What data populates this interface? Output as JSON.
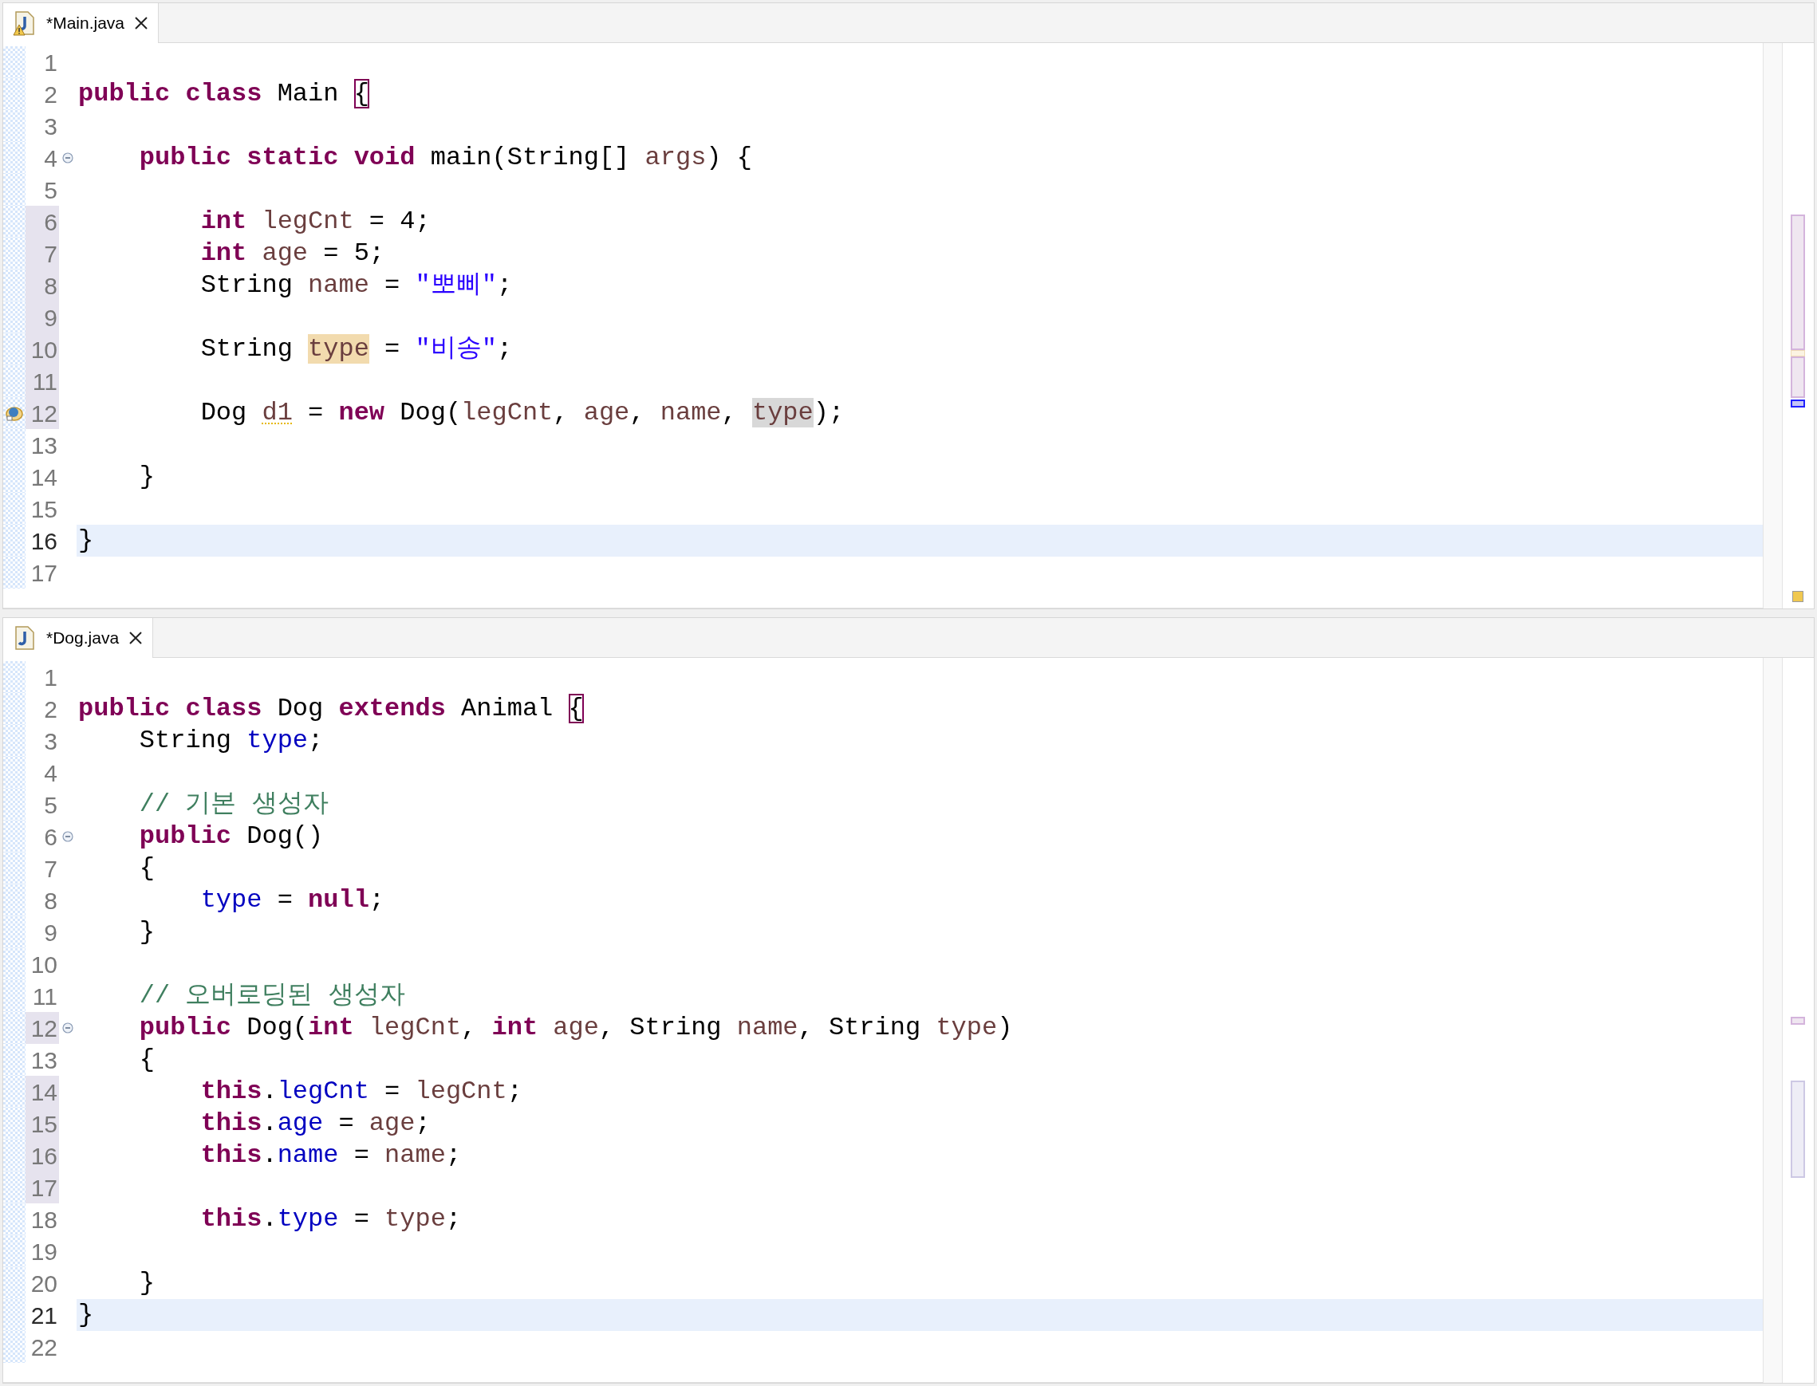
{
  "editors": [
    {
      "tab": {
        "label": "*Main.java",
        "warning": true
      },
      "lines": [
        {
          "number": "1",
          "changed": false,
          "current": false,
          "fold": false,
          "debug_marker": false
        },
        {
          "number": "2",
          "changed": false,
          "current": false,
          "fold": false,
          "debug_marker": false,
          "tokens": [
            {
              "text": "public class",
              "kind": "keyword"
            },
            {
              "text": " Main ",
              "kind": "plain"
            },
            {
              "text": "{",
              "kind": "matching_bracket"
            }
          ]
        },
        {
          "number": "3",
          "changed": false,
          "current": false,
          "fold": false,
          "debug_marker": false
        },
        {
          "number": "4",
          "changed": false,
          "current": false,
          "fold": true,
          "debug_marker": false,
          "tokens": [
            {
              "text": "    public static void",
              "kind": "keyword"
            },
            {
              "text": " main(String[] ",
              "kind": "plain"
            },
            {
              "text": "args",
              "kind": "local"
            },
            {
              "text": ") {",
              "kind": "plain"
            }
          ]
        },
        {
          "number": "5",
          "changed": false,
          "current": false,
          "fold": false,
          "debug_marker": false
        },
        {
          "number": "6",
          "changed": true,
          "current": false,
          "fold": false,
          "debug_marker": false,
          "tokens": [
            {
              "text": "        int",
              "kind": "keyword"
            },
            {
              "text": " legCnt",
              "kind": "local"
            },
            {
              "text": " = 4;",
              "kind": "plain"
            }
          ]
        },
        {
          "number": "7",
          "changed": true,
          "current": false,
          "fold": false,
          "debug_marker": false,
          "tokens": [
            {
              "text": "        int",
              "kind": "keyword"
            },
            {
              "text": " age",
              "kind": "local"
            },
            {
              "text": " = 5;",
              "kind": "plain"
            }
          ]
        },
        {
          "number": "8",
          "changed": true,
          "current": false,
          "fold": false,
          "debug_marker": false,
          "tokens": [
            {
              "text": "        String ",
              "kind": "plain"
            },
            {
              "text": "name",
              "kind": "local"
            },
            {
              "text": " = ",
              "kind": "plain"
            },
            {
              "text": "\"뽀삐\"",
              "kind": "string"
            },
            {
              "text": ";",
              "kind": "plain"
            }
          ]
        },
        {
          "number": "9",
          "changed": true,
          "current": false,
          "fold": false,
          "debug_marker": false
        },
        {
          "number": "10",
          "changed": true,
          "current": false,
          "fold": false,
          "debug_marker": false,
          "tokens": [
            {
              "text": "        String ",
              "kind": "plain"
            },
            {
              "text": "type",
              "kind": "write_occurrence"
            },
            {
              "text": " = ",
              "kind": "plain"
            },
            {
              "text": "\"비송\"",
              "kind": "string"
            },
            {
              "text": ";",
              "kind": "plain"
            }
          ]
        },
        {
          "number": "11",
          "changed": true,
          "current": false,
          "fold": false,
          "debug_marker": false
        },
        {
          "number": "12",
          "changed": true,
          "current": false,
          "fold": false,
          "debug_marker": true,
          "tokens": [
            {
              "text": "        Dog ",
              "kind": "plain"
            },
            {
              "text": "d1",
              "kind": "warning_local"
            },
            {
              "text": " = ",
              "kind": "plain"
            },
            {
              "text": "new",
              "kind": "keyword"
            },
            {
              "text": " Dog(",
              "kind": "plain"
            },
            {
              "text": "legCnt",
              "kind": "local"
            },
            {
              "text": ", ",
              "kind": "plain"
            },
            {
              "text": "age",
              "kind": "local"
            },
            {
              "text": ", ",
              "kind": "plain"
            },
            {
              "text": "name",
              "kind": "local"
            },
            {
              "text": ", ",
              "kind": "plain"
            },
            {
              "text": "type",
              "kind": "read_occurrence"
            },
            {
              "text": ");",
              "kind": "plain"
            }
          ]
        },
        {
          "number": "13",
          "changed": false,
          "current": false,
          "fold": false,
          "debug_marker": false
        },
        {
          "number": "14",
          "changed": false,
          "current": false,
          "fold": false,
          "debug_marker": false,
          "tokens": [
            {
              "text": "    }",
              "kind": "plain"
            }
          ]
        },
        {
          "number": "15",
          "changed": false,
          "current": false,
          "fold": false,
          "debug_marker": false
        },
        {
          "number": "16",
          "changed": false,
          "current": true,
          "fold": false,
          "debug_marker": false,
          "tokens": [
            {
              "text": "}",
              "kind": "plain"
            }
          ]
        },
        {
          "number": "17",
          "changed": false,
          "current": false,
          "fold": false,
          "debug_marker": false
        }
      ]
    },
    {
      "tab": {
        "label": "*Dog.java",
        "warning": false
      },
      "lines": [
        {
          "number": "1",
          "changed": false,
          "current": false,
          "fold": false,
          "debug_marker": false
        },
        {
          "number": "2",
          "changed": false,
          "current": false,
          "fold": false,
          "debug_marker": false,
          "tokens": [
            {
              "text": "public class",
              "kind": "keyword"
            },
            {
              "text": " Dog ",
              "kind": "plain"
            },
            {
              "text": "extends",
              "kind": "keyword"
            },
            {
              "text": " Animal ",
              "kind": "plain"
            },
            {
              "text": "{",
              "kind": "matching_bracket"
            }
          ]
        },
        {
          "number": "3",
          "changed": false,
          "current": false,
          "fold": false,
          "debug_marker": false,
          "tokens": [
            {
              "text": "    String ",
              "kind": "plain"
            },
            {
              "text": "type",
              "kind": "field"
            },
            {
              "text": ";",
              "kind": "plain"
            }
          ]
        },
        {
          "number": "4",
          "changed": false,
          "current": false,
          "fold": false,
          "debug_marker": false
        },
        {
          "number": "5",
          "changed": false,
          "current": false,
          "fold": false,
          "debug_marker": false,
          "tokens": [
            {
              "text": "    // 기본 생성자",
              "kind": "comment"
            }
          ]
        },
        {
          "number": "6",
          "changed": false,
          "current": false,
          "fold": true,
          "debug_marker": false,
          "tokens": [
            {
              "text": "    public",
              "kind": "keyword"
            },
            {
              "text": " Dog()",
              "kind": "plain"
            }
          ]
        },
        {
          "number": "7",
          "changed": false,
          "current": false,
          "fold": false,
          "debug_marker": false,
          "tokens": [
            {
              "text": "    {",
              "kind": "plain"
            }
          ]
        },
        {
          "number": "8",
          "changed": false,
          "current": false,
          "fold": false,
          "debug_marker": false,
          "tokens": [
            {
              "text": "        type",
              "kind": "field"
            },
            {
              "text": " = ",
              "kind": "plain"
            },
            {
              "text": "null",
              "kind": "keyword"
            },
            {
              "text": ";",
              "kind": "plain"
            }
          ]
        },
        {
          "number": "9",
          "changed": false,
          "current": false,
          "fold": false,
          "debug_marker": false,
          "tokens": [
            {
              "text": "    }",
              "kind": "plain"
            }
          ]
        },
        {
          "number": "10",
          "changed": false,
          "current": false,
          "fold": false,
          "debug_marker": false
        },
        {
          "number": "11",
          "changed": false,
          "current": false,
          "fold": false,
          "debug_marker": false,
          "tokens": [
            {
              "text": "    // 오버로딩된 생성자",
              "kind": "comment"
            }
          ]
        },
        {
          "number": "12",
          "changed": true,
          "current": false,
          "fold": true,
          "debug_marker": false,
          "tokens": [
            {
              "text": "    public",
              "kind": "keyword"
            },
            {
              "text": " Dog(",
              "kind": "plain"
            },
            {
              "text": "int",
              "kind": "keyword"
            },
            {
              "text": " legCnt",
              "kind": "local"
            },
            {
              "text": ", ",
              "kind": "plain"
            },
            {
              "text": "int",
              "kind": "keyword"
            },
            {
              "text": " age",
              "kind": "local"
            },
            {
              "text": ", String ",
              "kind": "plain"
            },
            {
              "text": "name",
              "kind": "local"
            },
            {
              "text": ", String ",
              "kind": "plain"
            },
            {
              "text": "type",
              "kind": "local"
            },
            {
              "text": ")",
              "kind": "plain"
            }
          ]
        },
        {
          "number": "13",
          "changed": false,
          "current": false,
          "fold": false,
          "debug_marker": false,
          "tokens": [
            {
              "text": "    {",
              "kind": "plain"
            }
          ]
        },
        {
          "number": "14",
          "changed": true,
          "current": false,
          "fold": false,
          "debug_marker": false,
          "tokens": [
            {
              "text": "        this",
              "kind": "keyword"
            },
            {
              "text": ".",
              "kind": "plain"
            },
            {
              "text": "legCnt",
              "kind": "field"
            },
            {
              "text": " = ",
              "kind": "plain"
            },
            {
              "text": "legCnt",
              "kind": "local"
            },
            {
              "text": ";",
              "kind": "plain"
            }
          ]
        },
        {
          "number": "15",
          "changed": true,
          "current": false,
          "fold": false,
          "debug_marker": false,
          "tokens": [
            {
              "text": "        this",
              "kind": "keyword"
            },
            {
              "text": ".",
              "kind": "plain"
            },
            {
              "text": "age",
              "kind": "field"
            },
            {
              "text": " = ",
              "kind": "plain"
            },
            {
              "text": "age",
              "kind": "local"
            },
            {
              "text": ";",
              "kind": "plain"
            }
          ]
        },
        {
          "number": "16",
          "changed": true,
          "current": false,
          "fold": false,
          "debug_marker": false,
          "tokens": [
            {
              "text": "        this",
              "kind": "keyword"
            },
            {
              "text": ".",
              "kind": "plain"
            },
            {
              "text": "name",
              "kind": "field"
            },
            {
              "text": " = ",
              "kind": "plain"
            },
            {
              "text": "name",
              "kind": "local"
            },
            {
              "text": ";",
              "kind": "plain"
            }
          ]
        },
        {
          "number": "17",
          "changed": true,
          "current": false,
          "fold": false,
          "debug_marker": false
        },
        {
          "number": "18",
          "changed": false,
          "current": false,
          "fold": false,
          "debug_marker": false,
          "tokens": [
            {
              "text": "        this",
              "kind": "keyword"
            },
            {
              "text": ".",
              "kind": "plain"
            },
            {
              "text": "type",
              "kind": "field"
            },
            {
              "text": " = ",
              "kind": "plain"
            },
            {
              "text": "type",
              "kind": "local"
            },
            {
              "text": ";",
              "kind": "plain"
            }
          ]
        },
        {
          "number": "19",
          "changed": false,
          "current": false,
          "fold": false,
          "debug_marker": false
        },
        {
          "number": "20",
          "changed": false,
          "current": false,
          "fold": false,
          "debug_marker": false,
          "tokens": [
            {
              "text": "    }",
              "kind": "plain"
            }
          ]
        },
        {
          "number": "21",
          "changed": false,
          "current": true,
          "fold": false,
          "debug_marker": false,
          "tokens": [
            {
              "text": "}",
              "kind": "plain"
            }
          ]
        },
        {
          "number": "22",
          "changed": false,
          "current": false,
          "fold": false,
          "debug_marker": false
        }
      ]
    }
  ]
}
